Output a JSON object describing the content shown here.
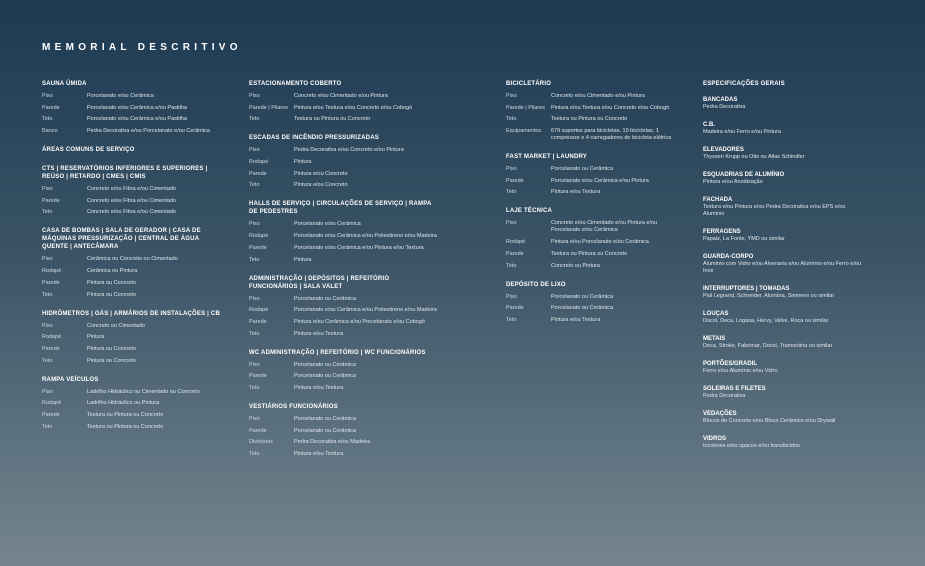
{
  "title": "MEMORIAL DESCRITIVO",
  "columns": [
    {
      "sections": [
        {
          "title": "SAUNA ÚMIDA",
          "rows": [
            {
              "label": "Piso",
              "value": "Porcelanato e/ou Cerâmica"
            },
            {
              "label": "Parede",
              "value": "Porcelanato e/ou Cerâmica e/ou Pastilha"
            },
            {
              "label": "Teto",
              "value": "Porcelanato e/ou Cerâmica e/ou Pastilha"
            },
            {
              "label": "Banco",
              "value": "Pedra Decorativa e/ou Porcelanato e/ou Cerâmica"
            }
          ]
        },
        {
          "title": "ÁREAS COMUNS DE SERVIÇO",
          "rows": []
        },
        {
          "title": "CTS | RESERVATÓRIOS INFERIORES E SUPERIORES | REÚSO | RETARDO | CMEs | CMIs",
          "rows": [
            {
              "label": "Piso",
              "value": "Concreto e/ou Fibra e/ou Cimentado"
            },
            {
              "label": "Parede",
              "value": "Concreto e/ou Fibra e/ou Cimentado"
            },
            {
              "label": "Teto",
              "value": "Concreto e/ou Fibra e/ou Cimentado"
            }
          ]
        },
        {
          "title": "CASA DE BOMBAS | SALA DE GERADOR | CASA DE MÁQUINAS PRESSURIZAÇÃO | CENTRAL DE ÁGUA QUENTE | ANTECÂMARA",
          "rows": [
            {
              "label": "Piso",
              "value": "Cerâmica ou Concreto ou Cimentado"
            },
            {
              "label": "Rodapé",
              "value": "Cerâmica ou Pintura"
            },
            {
              "label": "Parede",
              "value": "Pintura ou Concreto"
            },
            {
              "label": "Teto",
              "value": "Pintura ou Concreto"
            }
          ]
        },
        {
          "title": "HIDRÔMETROS | GÁS | ARMÁRIOS DE INSTALAÇÕES | CB",
          "rows": [
            {
              "label": "Piso",
              "value": "Concreto ou Cimentado"
            },
            {
              "label": "Rodapé",
              "value": "Pintura"
            },
            {
              "label": "Parede",
              "value": "Pintura ou Concreto"
            },
            {
              "label": "Teto",
              "value": "Pintura ou Concreto"
            }
          ]
        },
        {
          "title": "RAMPA VEÍCULOS",
          "rows": [
            {
              "label": "Piso",
              "value": "Ladrilho Hidráulico ou Cimentado ou Concreto"
            },
            {
              "label": "Rodapé",
              "value": "Ladrilho Hidráulico ou Pintura"
            },
            {
              "label": "Parede",
              "value": "Textura ou Pintura ou Concreto"
            },
            {
              "label": "Teto",
              "value": "Textura ou Pintura ou Concreto"
            }
          ]
        }
      ]
    },
    {
      "sections": [
        {
          "title": "ESTACIONAMENTO COBERTO",
          "rows": [
            {
              "label": "Piso",
              "value": "Concreto e/ou Cimentado e/ou Pintura"
            },
            {
              "label": "Parede | Pilares",
              "value": "Pintura e/ou Textura e/ou Concreto e/ou Cobogó"
            },
            {
              "label": "Teto",
              "value": "Textura ou Pintura ou Concreto"
            }
          ]
        },
        {
          "title": "ESCADAS DE INCÊNDIO PRESSURIZADAS",
          "rows": [
            {
              "label": "Piso",
              "value": "Pedra Decorativa e/ou Concreto e/ou Pintura"
            },
            {
              "label": "Rodapé",
              "value": "Pintura"
            },
            {
              "label": "Parede",
              "value": "Pintura e/ou Concreto"
            },
            {
              "label": "Teto",
              "value": "Pintura e/ou Concreto"
            }
          ]
        },
        {
          "title": "HALLS DE SERVIÇO | CIRCULAÇÕES DE SERVIÇO | RAMPA DE PEDESTRES",
          "rows": [
            {
              "label": "Piso",
              "value": "Porcelanato e/ou Cerâmica"
            },
            {
              "label": "Rodapé",
              "value": "Porcelanato e/ou Cerâmica e/ou Poliestireno e/ou Madeira"
            },
            {
              "label": "Parede",
              "value": "Porcelanato e/ou Cerâmica e/ou Pintura e/ou Textura"
            },
            {
              "label": "Teto",
              "value": "Pintura"
            }
          ]
        },
        {
          "title": "ADMINISTRAÇÃO | DEPÓSITOS | REFEITÓRIO FUNCIONÁRIOS | SALA VALET",
          "rows": [
            {
              "label": "Piso",
              "value": "Porcelanato ou Cerâmica"
            },
            {
              "label": "Rodapé",
              "value": "Porcelanato e/ou Cerâmica e/ou Poliestireno e/ou Madeira"
            },
            {
              "label": "Parede",
              "value": "Pintura e/ou Cerâmica e/ou Porcelanato e/ou Cobogó"
            },
            {
              "label": "Teto",
              "value": "Pintura e/ou Textura"
            }
          ]
        },
        {
          "title": "WC ADMINISTRAÇÃO | REFEITÓRIO | WC FUNCIONÁRIOS",
          "rows": [
            {
              "label": "Piso",
              "value": "Porcelanato ou Cerâmica"
            },
            {
              "label": "Parede",
              "value": "Porcelanato ou Cerâmica"
            },
            {
              "label": "Teto",
              "value": "Pintura e/ou Textura"
            }
          ]
        },
        {
          "title": "VESTIÁRIOS FUNCIONÁRIOS",
          "rows": [
            {
              "label": "Piso",
              "value": "Porcelanato ou Cerâmica"
            },
            {
              "label": "Parede",
              "value": "Porcelanato ou Cerâmica"
            },
            {
              "label": "Divisórias",
              "value": "Pedra Decorativa e/ou Madeira"
            },
            {
              "label": "Teto",
              "value": "Pintura e/ou Textura"
            }
          ]
        }
      ]
    },
    {
      "sections": [
        {
          "title": "BICICLETÁRIO",
          "rows": [
            {
              "label": "Piso",
              "value": "Concreto e/ou Cimentado e/ou Pintura"
            },
            {
              "label": "Parede | Pilares",
              "value": "Pintura e/ou Textura e/ou Concreto e/ou Cobogó"
            },
            {
              "label": "Teto",
              "value": "Textura ou Pintura ou Concreto"
            },
            {
              "label": "Equipamentos",
              "value": "679 suportes para bicicletas, 10 bicicletas, 1 compressor e 4 carregadores de bicicleta elétrica"
            }
          ]
        },
        {
          "title": "FAST MARKET | LAUNDRY",
          "rows": [
            {
              "label": "Piso",
              "value": "Porcelanato ou Cerâmica"
            },
            {
              "label": "Parede",
              "value": "Porcelanato e/ou Cerâmica e/ou Pintura"
            },
            {
              "label": "Teto",
              "value": "Pintura e/ou Textura"
            }
          ]
        },
        {
          "title": "LAJE TÉCNICA",
          "rows": [
            {
              "label": "Piso",
              "value": "Concreto e/ou Cimentado e/ou Pintura e/ou Porcelanato e/ou Cerâmica"
            },
            {
              "label": "Rodapé",
              "value": "Pintura e/ou Porcelanato e/ou Cerâmica"
            },
            {
              "label": "Parede",
              "value": "Textura ou Pintura ou Concreto"
            },
            {
              "label": "Teto",
              "value": "Concreto ou Pintura"
            }
          ]
        },
        {
          "title": "DEPÓSITO DE LIXO",
          "rows": [
            {
              "label": "Piso",
              "value": "Porcelanato ou Cerâmica"
            },
            {
              "label": "Parede",
              "value": "Porcelanato ou Cerâmica"
            },
            {
              "label": "Teto",
              "value": "Pintura e/ou Textura"
            }
          ]
        }
      ]
    }
  ],
  "specs": {
    "title": "ESPECIFICAÇÕES GERAIS",
    "items": [
      {
        "title": "BANCADAS",
        "value": "Pedra Decorativa"
      },
      {
        "title": "C.B.",
        "value": "Madeira e/ou Ferro e/ou Pintura"
      },
      {
        "title": "ELEVADORES",
        "value": "Thyssen Krupp ou Otis ou Atlas Schindler"
      },
      {
        "title": "ESQUADRIAS DE ALUMÍNIO",
        "value": "Pintura e/ou Anodização"
      },
      {
        "title": "FACHADA",
        "value": "Textura e/ou Pintura e/ou Pedra Decorativa e/ou EPS e/ou Alumínio"
      },
      {
        "title": "FERRAGENS",
        "value": "Papaiz, La Fonte, YMD ou similar"
      },
      {
        "title": "GUARDA-CORPO",
        "value": "Alumínio com Vidro e/ou Alvenaria e/ou Alumínio e/ou Ferro e/ou Inox"
      },
      {
        "title": "INTERRUPTORES | TOMADAS",
        "value": "Pial Legrand, Schneider, Alumbra, Siemens ou similar"
      },
      {
        "title": "LOUÇAS",
        "value": "Docol, Deca, Logasa, Hervy, Valve, Roca ou similar"
      },
      {
        "title": "METAIS",
        "value": "Deca, Stroke, Fabrimar, Docol, Tramontina ou similar"
      },
      {
        "title": "PORTÕES/GRADIL",
        "value": "Ferro e/ou Alumínio e/ou Vidro"
      },
      {
        "title": "SOLEIRAS E FILETES",
        "value": "Pedra Decorativa"
      },
      {
        "title": "VEDAÇÕES",
        "value": "Blocos de Concreto e/ou Bloco Cerâmico e/ou Drywall"
      },
      {
        "title": "VIDROS",
        "value": "Incolores e/ou opacos e/ou translúcidos"
      }
    ]
  }
}
